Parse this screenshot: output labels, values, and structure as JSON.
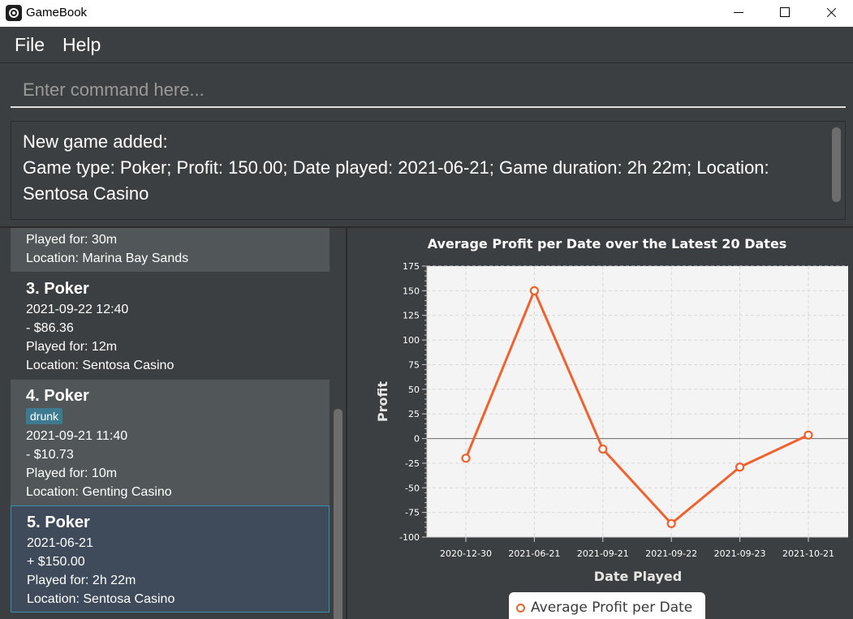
{
  "window": {
    "title": "GameBook"
  },
  "menu": {
    "file": "File",
    "help": "Help"
  },
  "command": {
    "placeholder": "Enter command here...",
    "value": ""
  },
  "result": {
    "text": "New game added:\nGame type: Poker; Profit: 150.00; Date played: 2021-06-21; Game duration: 2h 22m; Location: Sentosa Casino"
  },
  "games": [
    {
      "lines": [
        "Played for: 30m",
        "Location: Marina Bay Sands"
      ]
    },
    {
      "title": "3.  Poker",
      "lines": [
        "2021-09-22 12:40",
        "- $86.36",
        "Played for: 12m",
        "Location: Sentosa Casino"
      ]
    },
    {
      "title": "4.  Poker",
      "tag": "drunk",
      "lines": [
        "2021-09-21 11:40",
        "- $10.73",
        "Played for: 10m",
        "Location: Genting Casino"
      ]
    },
    {
      "title": "5.  Poker",
      "lines": [
        "2021-06-21",
        "+ $150.00",
        "Played for: 2h 22m",
        "Location: Sentosa Casino"
      ]
    }
  ],
  "chart_data": {
    "type": "line",
    "title": "Average Profit per Date over the Latest 20 Dates",
    "xlabel": "Date Played",
    "ylabel": "Profit",
    "categories": [
      "2020-12-30",
      "2021-06-21",
      "2021-09-21",
      "2021-09-22",
      "2021-09-23",
      "2021-10-21"
    ],
    "series": [
      {
        "name": "Average Profit per Date",
        "values": [
          -20,
          150,
          -10.73,
          -86.36,
          -29,
          3.5
        ]
      }
    ],
    "ylim": [
      -100,
      175
    ],
    "yticks": [
      175,
      150,
      125,
      100,
      75,
      50,
      25,
      0,
      -25,
      -50,
      -75,
      -100
    ],
    "grid": true,
    "legend": "bottom",
    "colors": {
      "line": "#f0622d",
      "plot_bg": "#f4f4f4",
      "grid": "#d8d8d8"
    }
  }
}
